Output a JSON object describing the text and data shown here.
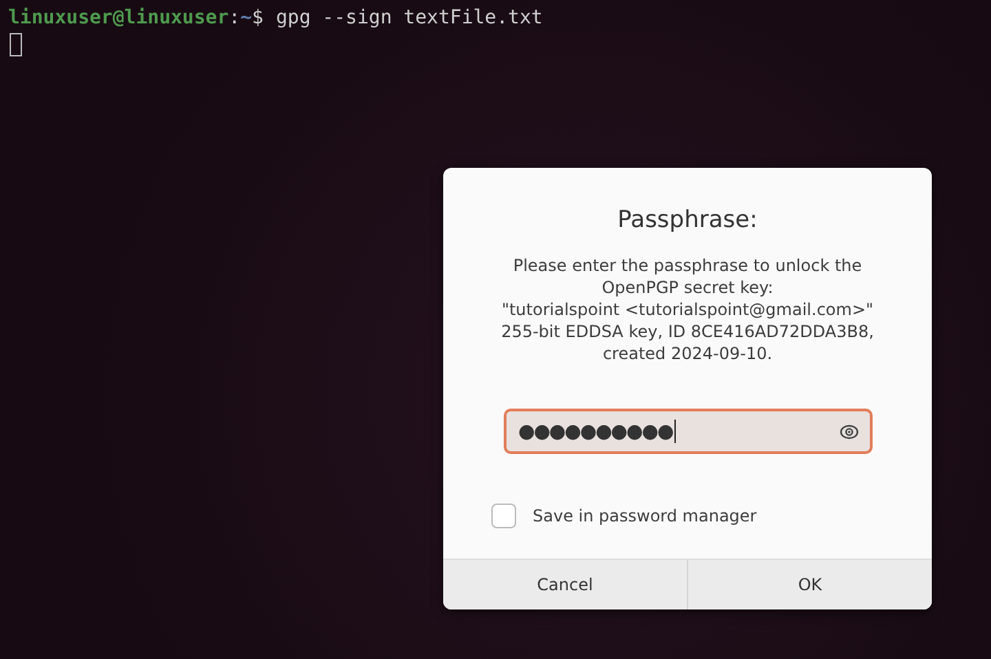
{
  "terminal": {
    "prompt_user": "linuxuser@linuxuser",
    "prompt_sep": ":",
    "prompt_path": "~",
    "prompt_sign": "$",
    "command": "gpg --sign textFile.txt"
  },
  "dialog": {
    "title": "Passphrase:",
    "message_lines": [
      "Please enter the passphrase to unlock the",
      "OpenPGP secret key:",
      "\"tutorialspoint <tutorialspoint@gmail.com>\"",
      "255-bit EDDSA key, ID 8CE416AD72DDA3B8,",
      "created 2024-09-10."
    ],
    "passphrase": {
      "value": "●●●●●●●●●●",
      "focused": true
    },
    "save_checkbox": {
      "label": "Save in password manager",
      "checked": false
    },
    "buttons": [
      "Cancel",
      "OK"
    ]
  }
}
